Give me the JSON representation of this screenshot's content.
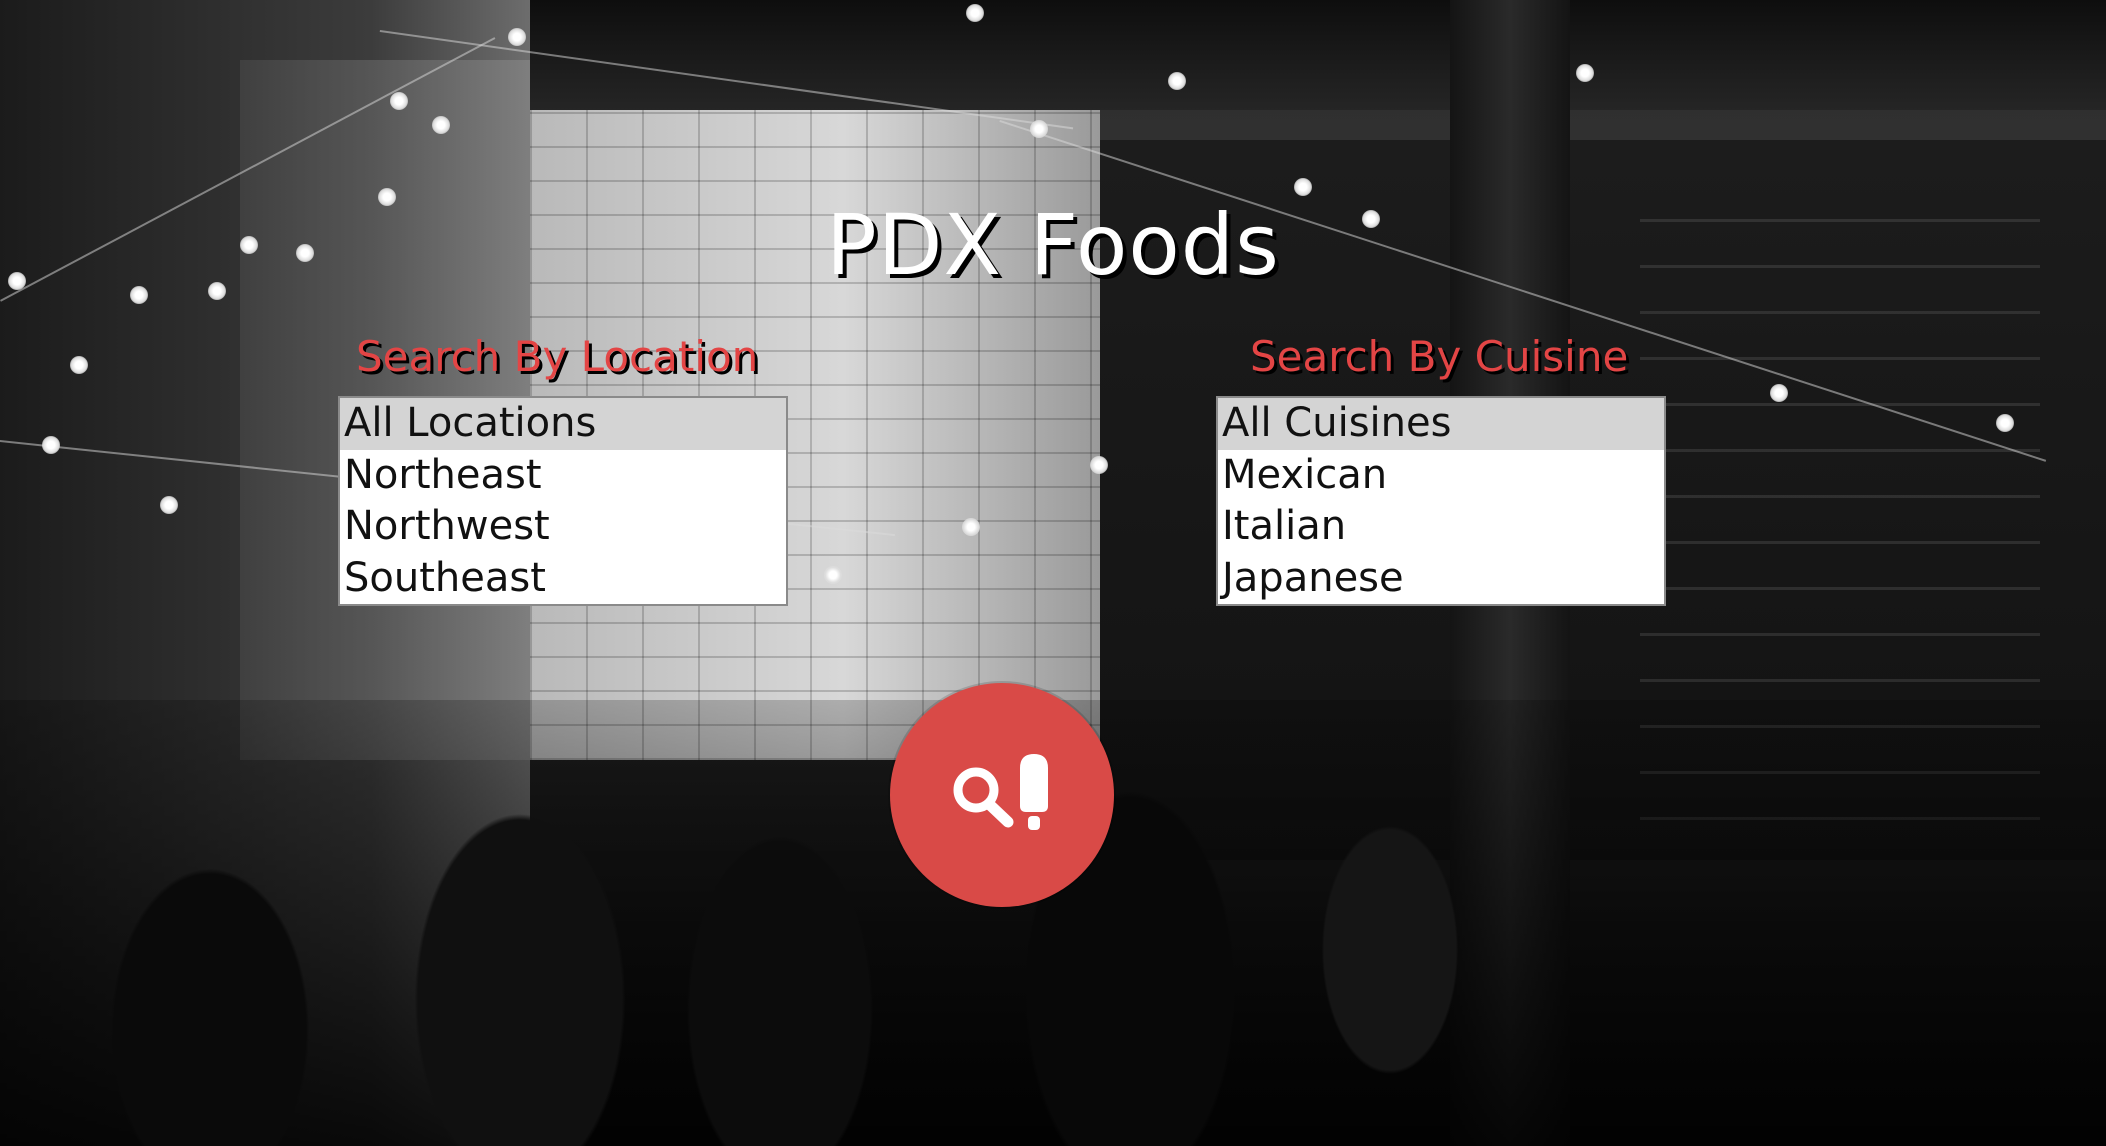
{
  "app": {
    "title": "PDX Foods"
  },
  "location": {
    "label": "Search By Location",
    "options": [
      "All Locations",
      "Northeast",
      "Northwest",
      "Southeast"
    ],
    "selected": "All Locations"
  },
  "cuisine": {
    "label": "Search By Cuisine",
    "options": [
      "All Cuisines",
      "Mexican",
      "Italian",
      "Japanese"
    ],
    "selected": "All Cuisines"
  },
  "search_button": {
    "icon": "search-food-icon"
  },
  "colors": {
    "accent": "#d94a47",
    "label_red": "#e34545",
    "title_text": "#ffffff",
    "selected_option_bg": "#d4d4d4"
  },
  "background": {
    "image": "restaurant-interior-photo"
  }
}
